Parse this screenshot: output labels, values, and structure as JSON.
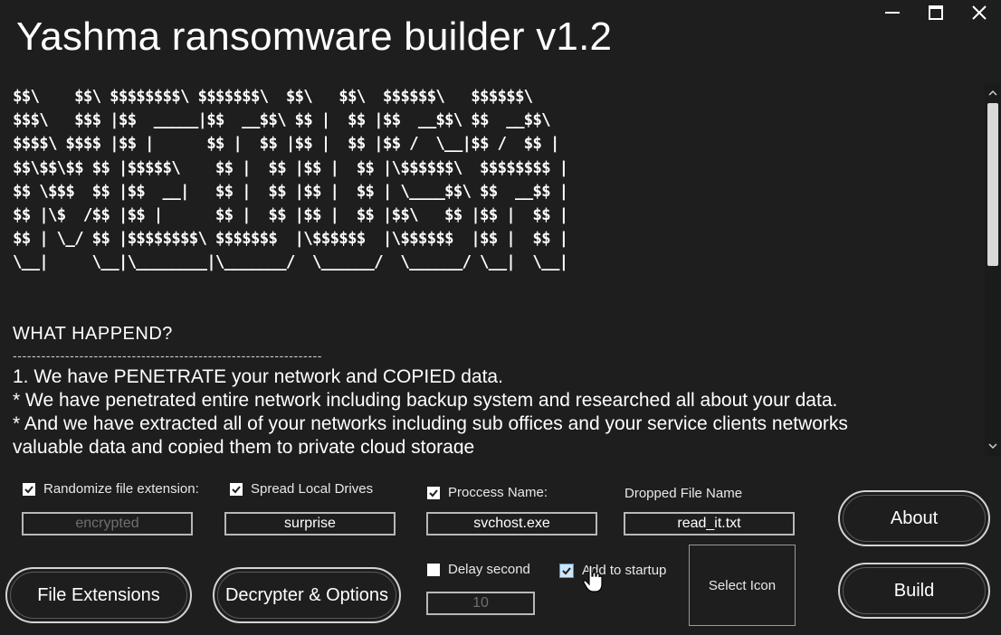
{
  "window": {
    "title": "Yashma ransomware builder v1.2",
    "controls": [
      "minimize-icon",
      "maximize-icon",
      "close-icon"
    ]
  },
  "ransom_note": {
    "ascii_banner": [
      "$$\\    $$\\ $$$$$$$$\\ $$$$$$$\\  $$\\   $$\\  $$$$$$\\   $$$$$$\\",
      "$$$\\   $$$ |$$  _____|$$  __$$\\ $$ |  $$ |$$  __$$\\ $$  __$$\\",
      "$$$$\\ $$$$ |$$ |      $$ |  $$ |$$ |  $$ |$$ /  \\__|$$ /  $$ |",
      "$$\\$$\\$$ $$ |$$$$$\\    $$ |  $$ |$$ |  $$ |\\$$$$$$\\  $$$$$$$$ |",
      "$$ \\$$$  $$ |$$  __|   $$ |  $$ |$$ |  $$ | \\____$$\\ $$  __$$ |",
      "$$ |\\$  /$$ |$$ |      $$ |  $$ |$$ |  $$ |$$\\   $$ |$$ |  $$ |",
      "$$ | \\_/ $$ |$$$$$$$$\\ $$$$$$$  |\\$$$$$$  |\\$$$$$$  |$$ |  $$ |",
      "\\__|     \\__|\\________|\\_______/  \\______/  \\______/ \\__|  \\__|"
    ],
    "heading": "WHAT HAPPEND?",
    "divider": "-----------------------------------------------------------------",
    "lines": [
      "1. We have PENETRATE your network and COPIED data.",
      "* We have penetrated entire network including backup system and researched all about your data.",
      "* And we have extracted all of your networks including sub offices and your service clients networks",
      "valuable data and copied them to private cloud storage"
    ]
  },
  "options": {
    "randomize_ext": {
      "label": "Randomize file extension:",
      "checked": true,
      "value": "encrypted"
    },
    "spread_drives": {
      "label": "Spread Local Drives",
      "checked": true,
      "value": "surprise"
    },
    "process_name": {
      "label": "Proccess Name:",
      "checked": true,
      "value": "svchost.exe"
    },
    "dropped_file": {
      "label": "Dropped File Name",
      "value": "read_it.txt"
    },
    "delay": {
      "label": "Delay second",
      "checked": false,
      "value": "10"
    },
    "startup": {
      "label": "Add to startup",
      "checked": true
    }
  },
  "buttons": {
    "file_extensions": "File Extensions",
    "decrypter_options": "Decrypter & Options",
    "select_icon": "Select Icon",
    "about": "About",
    "build": "Build"
  },
  "colors": {
    "background": "#1e1e1e",
    "text": "#ffffff",
    "border": "#d4d4d4",
    "checkbox_accent": "#4a98d8"
  }
}
